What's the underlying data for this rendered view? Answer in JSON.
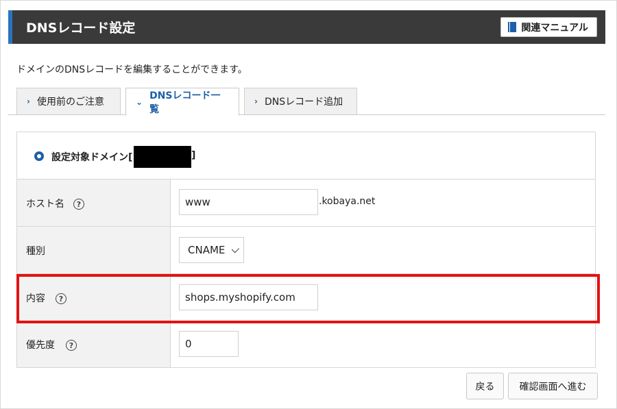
{
  "header": {
    "title": "DNSレコード設定",
    "manual_button": "関連マニュアル",
    "accent_color": "#2b73bf",
    "background_color": "#3a3a3a"
  },
  "description": "ドメインのDNSレコードを編集することができます。",
  "tabs": [
    {
      "label": "使用前のご注意",
      "active": false
    },
    {
      "label": "DNSレコード一覧",
      "active": true
    },
    {
      "label": "DNSレコード追加",
      "active": false
    }
  ],
  "form": {
    "domain_label": "設定対象ドメイン[",
    "domain_close": "]",
    "host": {
      "label": "ホスト名",
      "value": "www",
      "suffix": ".kobaya.net"
    },
    "type": {
      "label": "種別",
      "value": "CNAME"
    },
    "content": {
      "label": "内容",
      "value": "shops.myshopify.com"
    },
    "priority": {
      "label": "優先度",
      "value": "0"
    }
  },
  "help_glyph": "?",
  "buttons": {
    "back": "戻る",
    "confirm": "確認画面へ進む"
  },
  "highlight_color": "#e31212"
}
